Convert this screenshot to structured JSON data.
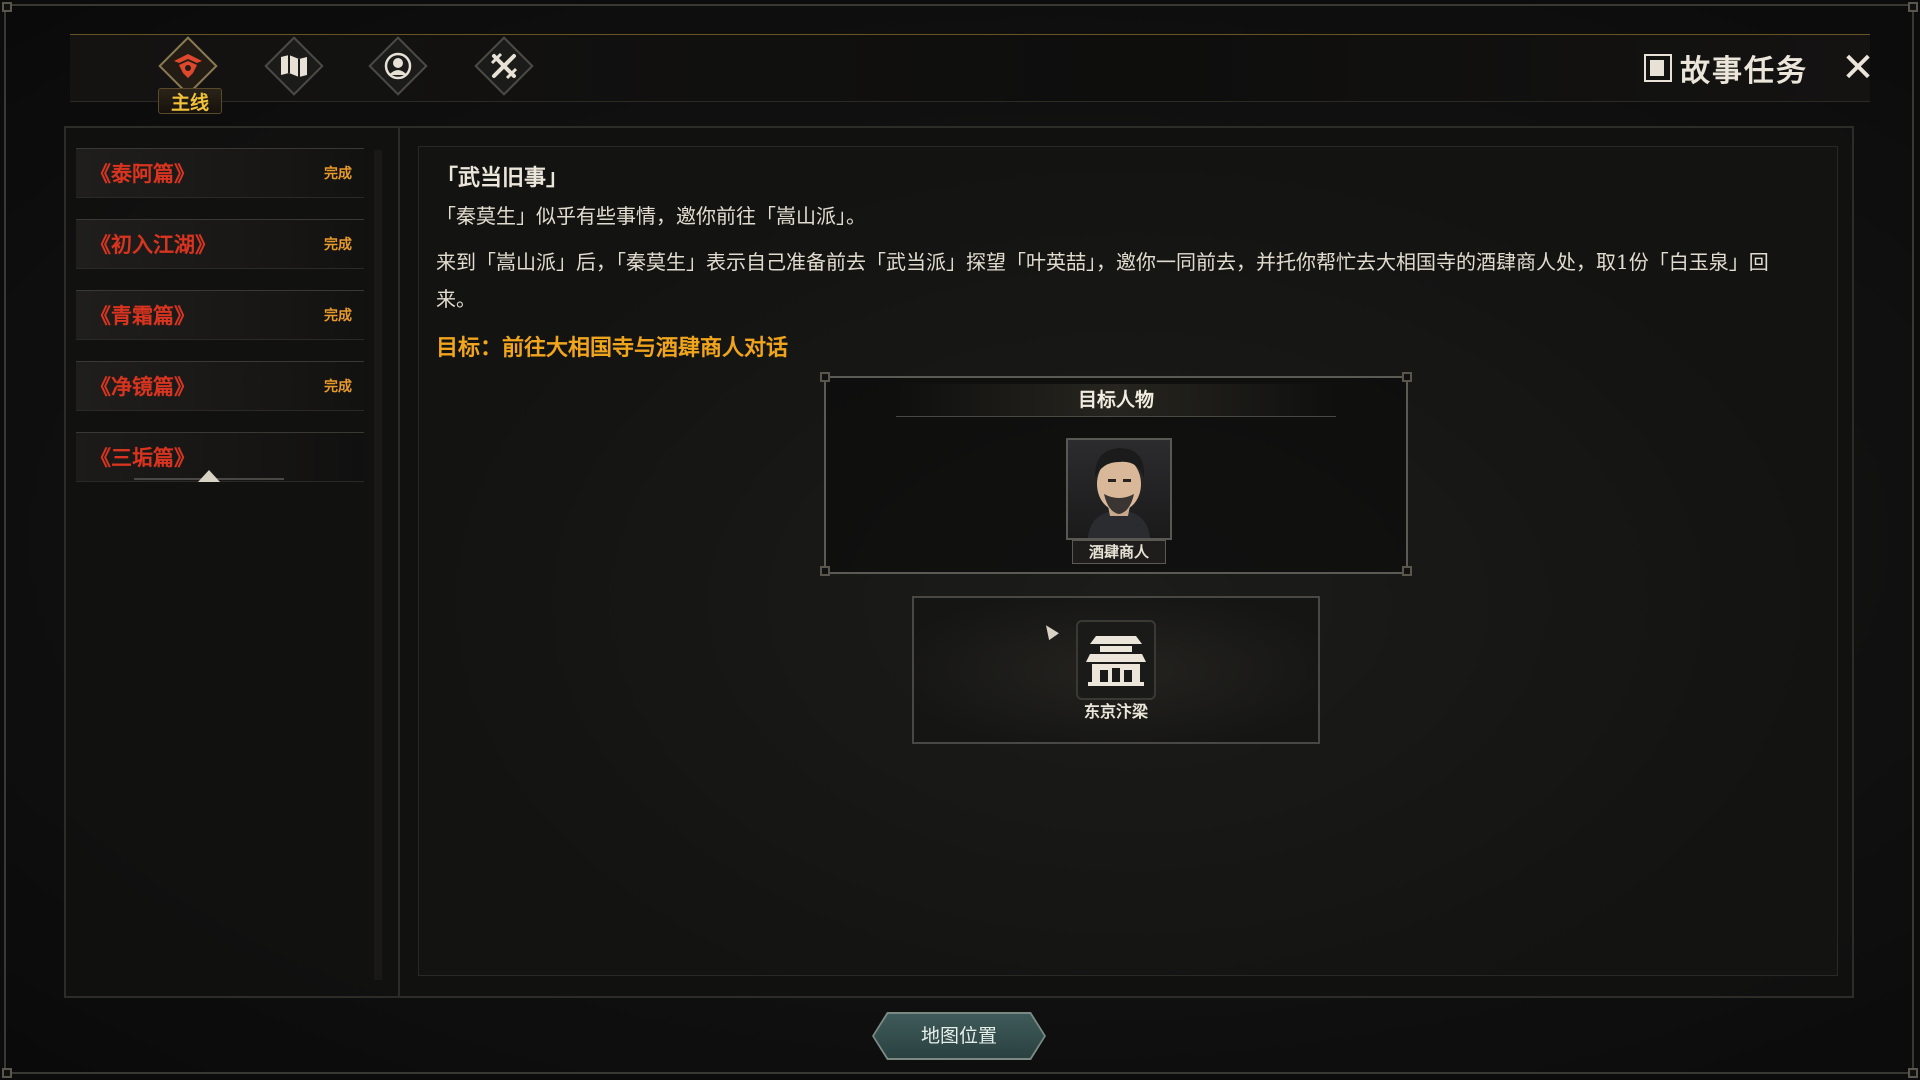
{
  "header": {
    "tabs": [
      {
        "icon": "main-quest-icon",
        "label": "主线",
        "active": true
      },
      {
        "icon": "scroll-map-icon",
        "active": false
      },
      {
        "icon": "person-portrait-icon",
        "active": false
      },
      {
        "icon": "crossed-swords-icon",
        "active": false
      }
    ],
    "title": "故事任务",
    "title_icon": "book-icon",
    "close_icon": "close-icon"
  },
  "chapters": [
    {
      "name": "《泰阿篇》",
      "status": "完成"
    },
    {
      "name": "《初入江湖》",
      "status": "完成"
    },
    {
      "name": "《青霜篇》",
      "status": "完成"
    },
    {
      "name": "《净镜篇》",
      "status": "完成"
    },
    {
      "name": "《三垢篇》",
      "status": ""
    }
  ],
  "quest": {
    "title": "「武当旧事」",
    "intro": "「秦莫生」似乎有些事情，邀你前往「嵩山派」。",
    "body": "来到「嵩山派」后，「秦莫生」表示自己准备前去「武当派」探望「叶英喆」，邀你一同前去，并托你帮忙去大相国寺的酒肆商人处，取1份「白玉泉」回来。",
    "objective_label": "目标：",
    "objective_text": "前往大相国寺与酒肆商人对话"
  },
  "target": {
    "header": "目标人物",
    "npc_name": "酒肆商人"
  },
  "location": {
    "name": "东京汴梁",
    "icon": "temple-building-icon"
  },
  "map_button": "地图位置",
  "colors": {
    "chapter_name": "#d8341f",
    "complete_status": "#e89a2a",
    "objective": "#f0a51c",
    "tab_label": "#f0c23a"
  }
}
